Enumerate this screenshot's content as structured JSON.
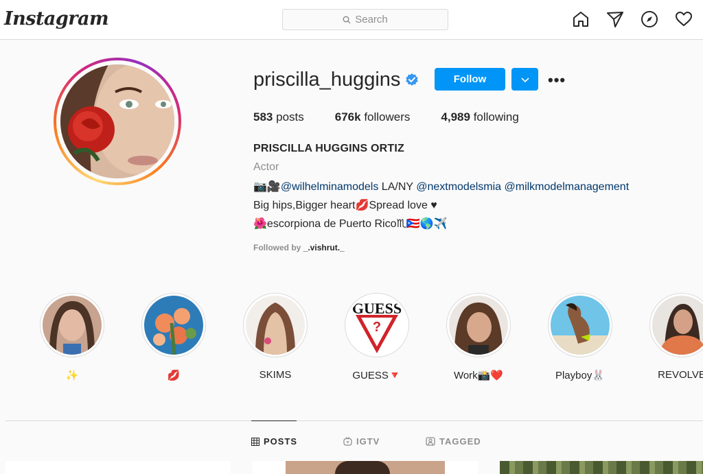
{
  "nav": {
    "logo": "Instagram",
    "search_placeholder": "Search",
    "icons": [
      "home-icon",
      "direct-icon",
      "explore-icon",
      "activity-icon"
    ]
  },
  "profile": {
    "username": "priscilla_huggins",
    "verified": true,
    "follow_label": "Follow",
    "more_label": "•••",
    "stats": [
      {
        "count": "583",
        "label": "posts"
      },
      {
        "count": "676k",
        "label": "followers"
      },
      {
        "count": "4,989",
        "label": "following"
      }
    ],
    "full_name": "PRISCILLA HUGGINS ORTIZ",
    "category": "Actor",
    "bio_line1_prefix": "📷🎥",
    "bio_mention1": "@wilhelminamodels",
    "bio_line1_mid": " LA/NY ",
    "bio_mention2": "@nextmodelsmia",
    "bio_mention3": "@milkmodelmanagement",
    "bio_line2": "Big hips,Bigger heart💋Spread love ♥",
    "bio_line3": "🌺escorpiona de Puerto Rico♏🇵🇷🌎✈️",
    "followed_by_prefix": "Followed by ",
    "followed_by_user": "_.vishrut._"
  },
  "highlights": [
    {
      "label": "✨"
    },
    {
      "label": "💋"
    },
    {
      "label": "SKIMS"
    },
    {
      "label": "GUESS🔻"
    },
    {
      "label": "Work📸❤️"
    },
    {
      "label": "Playboy🐰"
    },
    {
      "label": "REVOLVE"
    }
  ],
  "guess_logo_text": "GUESS",
  "tabs": [
    {
      "label": "POSTS",
      "active": true
    },
    {
      "label": "IGTV",
      "active": false
    },
    {
      "label": "TAGGED",
      "active": false
    }
  ],
  "colors": {
    "accent": "#0095f6",
    "mention": "#00376b",
    "muted": "#8e8e8e",
    "verified": "#3897f0"
  }
}
